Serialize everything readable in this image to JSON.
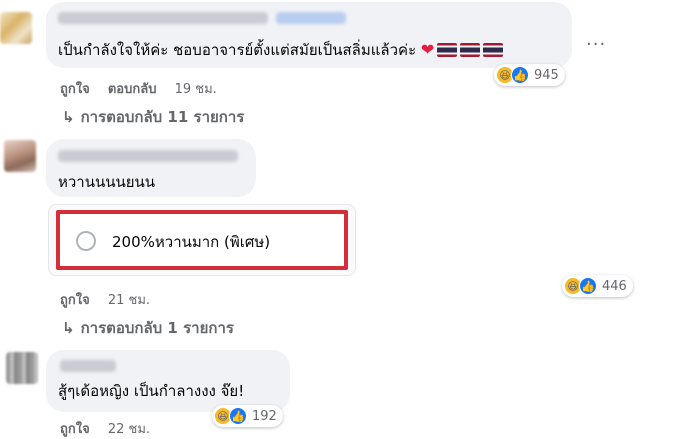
{
  "comments": [
    {
      "text": "เป็นกำลังใจให้ค่ะ ชอบอาจารย์ตั้งแต่สมัยเป็นสลิ่มแล้วค่ะ",
      "reaction_count": "945",
      "like_label": "ถูกใจ",
      "reply_label": "ตอบกลับ",
      "time": "19 ชม.",
      "replies_text": "การตอบกลับ 11 รายการ"
    },
    {
      "text": "หวานนนนยนน",
      "poll_option": "200%หวานมาก (พิเศษ)",
      "reaction_count": "446",
      "like_label": "ถูกใจ",
      "time": "21 ชม.",
      "replies_text": "การตอบกลับ 1 รายการ"
    },
    {
      "text": "สู้ๆเด้อหญิง เป็นกำลางงง จ๊ย!",
      "reaction_count": "192",
      "like_label": "ถูกใจ",
      "time": "22 ชม."
    }
  ],
  "icons": {
    "reply_arrow": "↳",
    "more": "···",
    "haha": "😆",
    "like": "👍",
    "heart": "❤"
  },
  "colors": {
    "bubble_bg": "#f0f2f5",
    "meta_text": "#65676b",
    "poll_highlight": "#d32f3a",
    "like_blue": "#1877f2"
  }
}
